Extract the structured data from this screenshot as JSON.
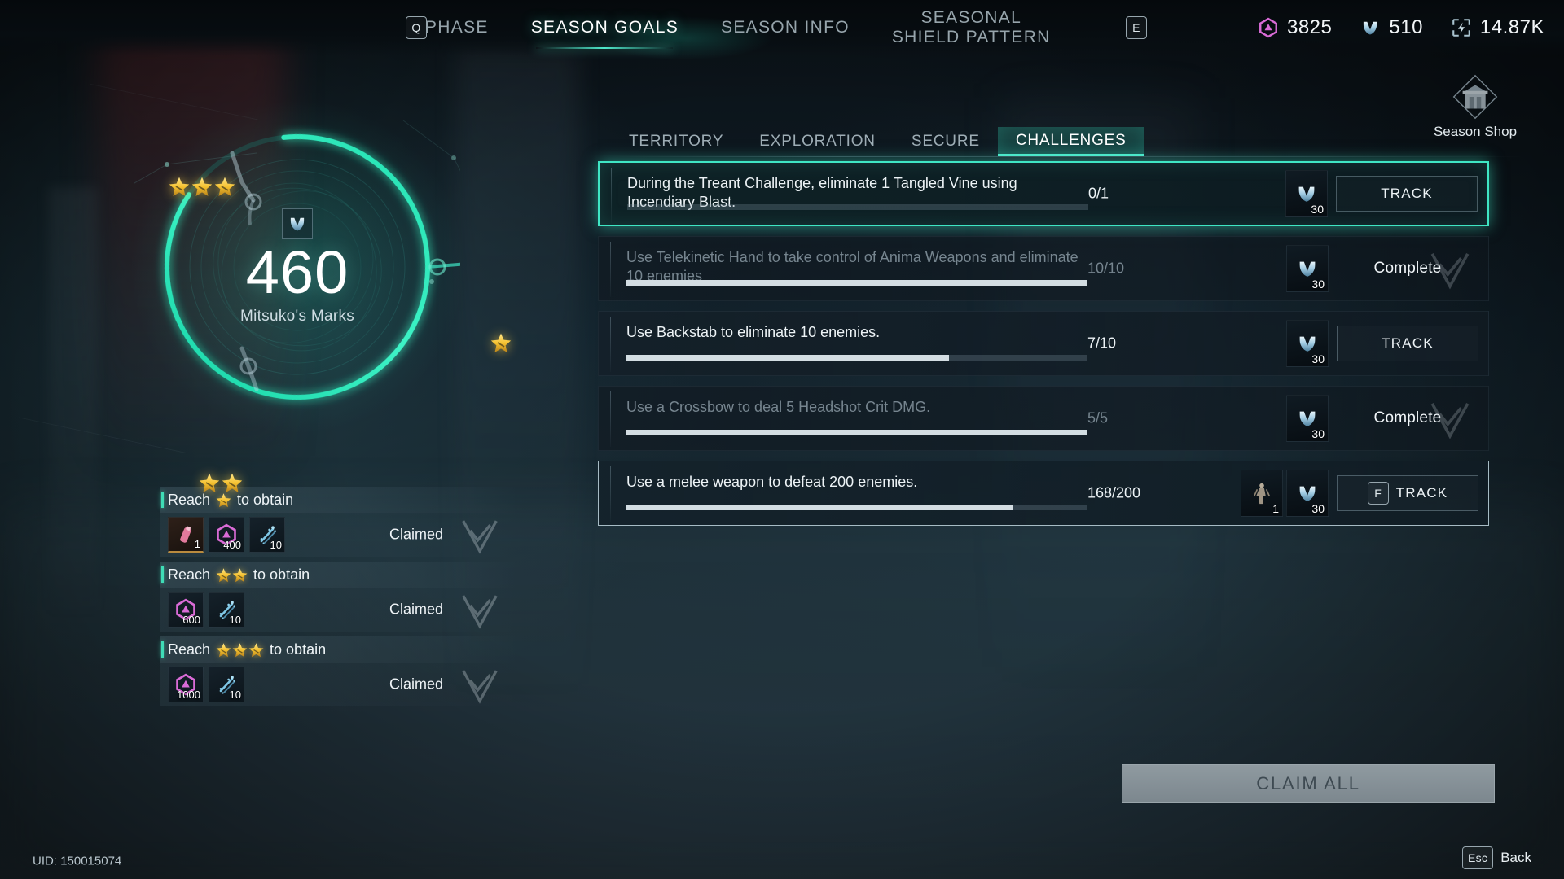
{
  "topbar": {
    "key_left": "Q",
    "key_right": "E",
    "tabs": [
      {
        "label": "PHASE",
        "active": false
      },
      {
        "label": "SEASON GOALS",
        "active": true
      },
      {
        "label": "SEASON INFO",
        "active": false
      },
      {
        "label": "SEASONAL\nSHIELD PATTERN",
        "active": false
      }
    ],
    "currencies": [
      {
        "icon": "hex-crystal-icon",
        "value": "3825",
        "color": "#d96bd6"
      },
      {
        "icon": "mitsuko-mark-icon",
        "value": "510",
        "color": "#9ccfe8"
      },
      {
        "icon": "energy-bolt-icon",
        "value": "14.87K",
        "color": "#a9c3cf"
      }
    ]
  },
  "season_progress": {
    "emblem": "mitsuko-mark-icon",
    "value": "460",
    "label": "Mitsuko's Marks",
    "ring_percent": 86,
    "ring_color": "#2fe3b4",
    "nodes": [
      {
        "name": "stars-top",
        "stars": 3
      },
      {
        "name": "stars-right",
        "stars": 1
      },
      {
        "name": "stars-bottom",
        "stars": 2
      }
    ]
  },
  "tiers": [
    {
      "label_prefix": "Reach",
      "label_suffix": "to obtain",
      "stars": 1,
      "rewards": [
        {
          "icon": "pink-cartridge-icon",
          "qty": "1",
          "rarity": "rare"
        },
        {
          "icon": "hex-crystal-icon",
          "qty": "400",
          "rarity": "common"
        },
        {
          "icon": "data-shard-icon",
          "qty": "10",
          "rarity": "common"
        }
      ],
      "state": "Claimed"
    },
    {
      "label_prefix": "Reach",
      "label_suffix": "to obtain",
      "stars": 2,
      "rewards": [
        {
          "icon": "hex-crystal-icon",
          "qty": "600",
          "rarity": "common"
        },
        {
          "icon": "data-shard-icon",
          "qty": "10",
          "rarity": "common"
        }
      ],
      "state": "Claimed"
    },
    {
      "label_prefix": "Reach",
      "label_suffix": "to obtain",
      "stars": 3,
      "rewards": [
        {
          "icon": "hex-crystal-icon",
          "qty": "1000",
          "rarity": "common"
        },
        {
          "icon": "data-shard-icon",
          "qty": "10",
          "rarity": "common"
        }
      ],
      "state": "Claimed"
    }
  ],
  "shop": {
    "icon": "season-shop-icon",
    "label": "Season Shop"
  },
  "sub_tabs": [
    {
      "label": "TERRITORY",
      "active": false
    },
    {
      "label": "EXPLORATION",
      "active": false
    },
    {
      "label": "SECURE",
      "active": false
    },
    {
      "label": "CHALLENGES",
      "active": true
    }
  ],
  "challenges": [
    {
      "text": "During the Treant Challenge, eliminate 1 Tangled Vine using Incendiary Blast.",
      "count": "0/1",
      "progress": 0,
      "state": "selected",
      "rewards": [
        {
          "icon": "mitsuko-mark-icon",
          "qty": "30"
        }
      ],
      "action": {
        "type": "button",
        "label": "TRACK",
        "key": ""
      }
    },
    {
      "text": "Use Telekinetic Hand to take control of Anima Weapons and eliminate 10 enemies",
      "count": "10/10",
      "progress": 100,
      "state": "complete",
      "rewards": [
        {
          "icon": "mitsuko-mark-icon",
          "qty": "30"
        }
      ],
      "action": {
        "type": "text",
        "label": "Complete",
        "key": ""
      }
    },
    {
      "text": "Use Backstab to eliminate 10 enemies.",
      "count": "7/10",
      "progress": 70,
      "state": "normal",
      "rewards": [
        {
          "icon": "mitsuko-mark-icon",
          "qty": "30"
        }
      ],
      "action": {
        "type": "button",
        "label": "TRACK",
        "key": ""
      }
    },
    {
      "text": "Use a Crossbow to deal 5 Headshot Crit DMG.",
      "count": "5/5",
      "progress": 100,
      "state": "complete",
      "rewards": [
        {
          "icon": "mitsuko-mark-icon",
          "qty": "30"
        }
      ],
      "action": {
        "type": "text",
        "label": "Complete",
        "key": ""
      }
    },
    {
      "text": "Use a melee weapon to defeat 200 enemies.",
      "count": "168/200",
      "progress": 84,
      "state": "focused",
      "rewards": [
        {
          "icon": "figurine-icon",
          "qty": "1"
        },
        {
          "icon": "mitsuko-mark-icon",
          "qty": "30"
        }
      ],
      "action": {
        "type": "button",
        "label": "TRACK",
        "key": "F"
      }
    }
  ],
  "claim_all": {
    "label": "CLAIM ALL",
    "enabled": false
  },
  "footer": {
    "uid": "UID: 150015074",
    "back_key": "Esc",
    "back_label": "Back"
  }
}
